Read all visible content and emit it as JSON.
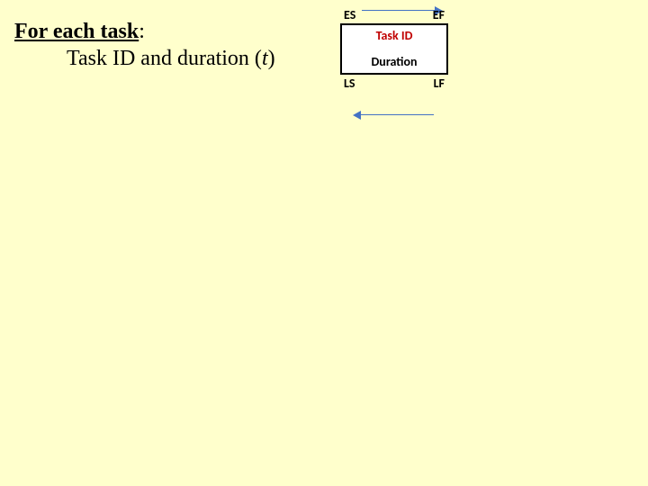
{
  "heading": {
    "lead": "For each task",
    "tail": ":"
  },
  "subline": {
    "pre": "Task ID and duration (",
    "var": "t",
    "post": ")"
  },
  "diagram": {
    "top_left": "ES",
    "top_right": "EF",
    "box_top": "Task ID",
    "box_bottom": "Duration",
    "bottom_left": "LS",
    "bottom_right": "LF"
  }
}
